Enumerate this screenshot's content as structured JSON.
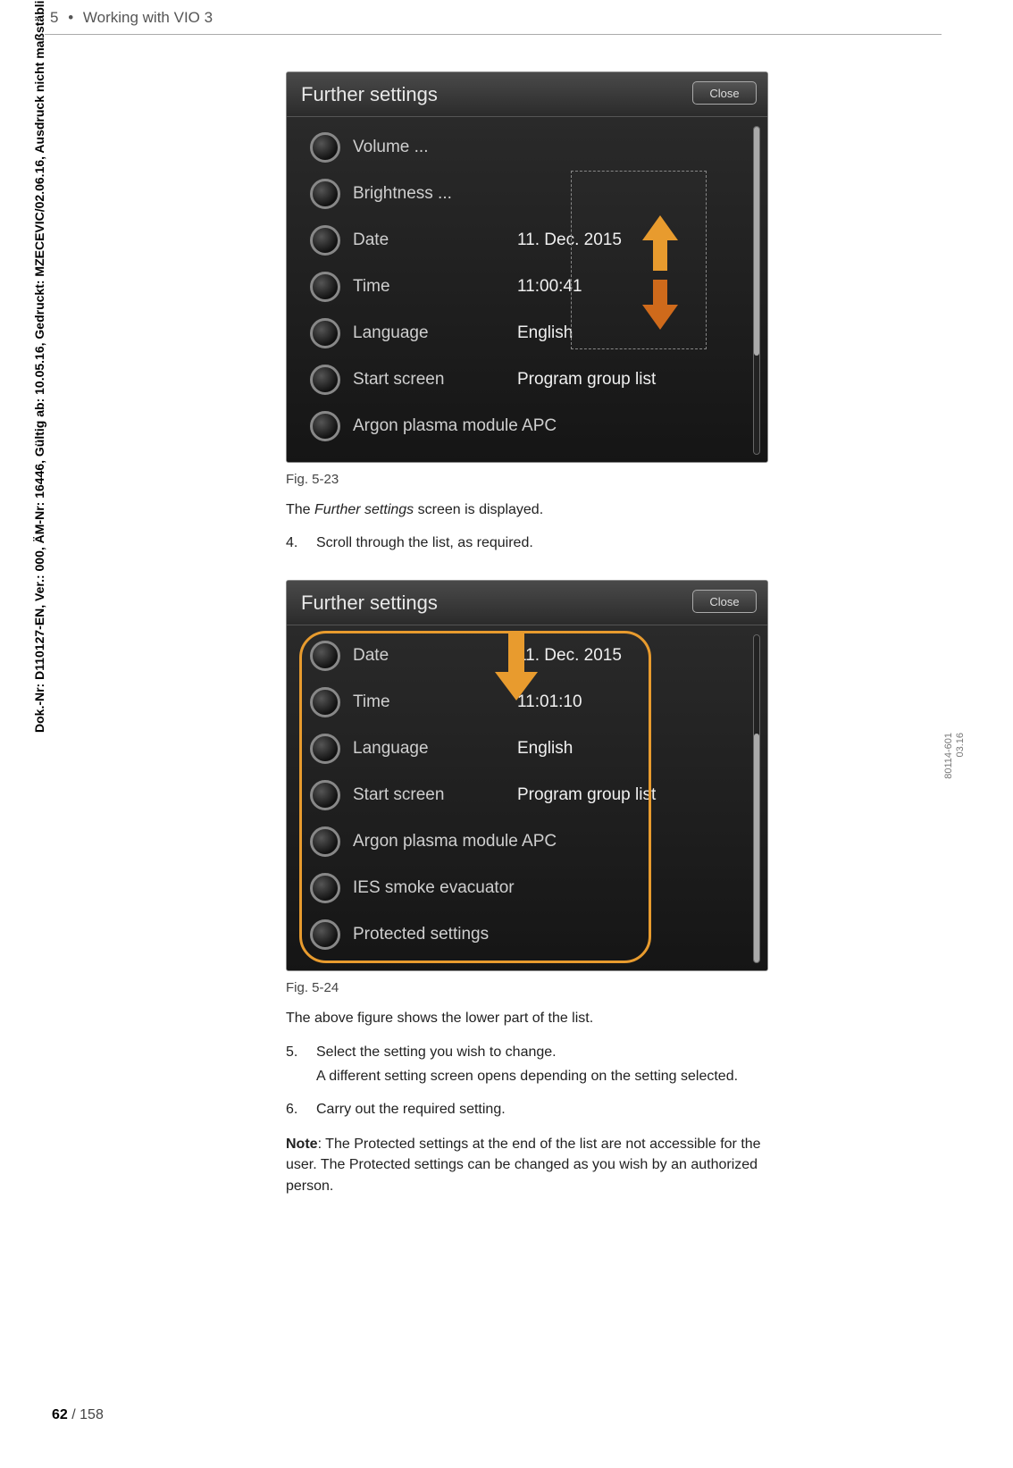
{
  "header": {
    "chapter_num": "5",
    "bullet": "•",
    "chapter_title": "Working with VIO 3"
  },
  "side_note": "Dok.-Nr: D110127-EN, Ver.: 000, ÄM-Nr: 16446, Gültig ab: 10.05.16, Gedruckt: MZECEVIC/02.06.16, Ausdruck nicht maßstäblich und kein Original.",
  "right_note_1": "80114-601",
  "right_note_2": "03.16",
  "page_current": "62",
  "page_sep": " / ",
  "page_total": "158",
  "screenshot1": {
    "title": "Further settings",
    "close": "Close",
    "rows": [
      {
        "label": "Volume ...",
        "value": ""
      },
      {
        "label": "Brightness ...",
        "value": ""
      },
      {
        "label": "Date",
        "value": "11. Dec. 2015"
      },
      {
        "label": "Time",
        "value": "11:00:41"
      },
      {
        "label": "Language",
        "value": "English"
      },
      {
        "label": "Start screen",
        "value": "Program group list"
      },
      {
        "label": "Argon plasma module APC",
        "value": ""
      }
    ]
  },
  "caption1": "Fig. 5-23",
  "para1_a": "The ",
  "para1_i": "Further settings",
  "para1_b": " screen is displayed.",
  "step4_num": "4.",
  "step4_text": "Scroll through the list, as required.",
  "screenshot2": {
    "title": "Further settings",
    "close": "Close",
    "rows": [
      {
        "label": "Date",
        "value": "11. Dec. 2015"
      },
      {
        "label": "Time",
        "value": "11:01:10"
      },
      {
        "label": "Language",
        "value": "English"
      },
      {
        "label": "Start screen",
        "value": "Program group list"
      },
      {
        "label": "Argon plasma module APC",
        "value": ""
      },
      {
        "label": "IES smoke evacuator",
        "value": ""
      },
      {
        "label": "Protected settings",
        "value": ""
      }
    ]
  },
  "caption2": "Fig. 5-24",
  "para2": "The above figure shows the lower part of the list.",
  "step5_num": "5.",
  "step5_text": "Select the setting you wish to change.",
  "step5_sub": "A different setting screen opens depending on the setting selected.",
  "step6_num": "6.",
  "step6_text": "Carry out the required setting.",
  "note_bold": "Note",
  "note_a": ": The ",
  "note_i1": "Protected settings",
  "note_b": " at the end of the list are not accessible for the user. The ",
  "note_i2": "Protected settings",
  "note_c": " can be changed as you wish by an authorized person."
}
